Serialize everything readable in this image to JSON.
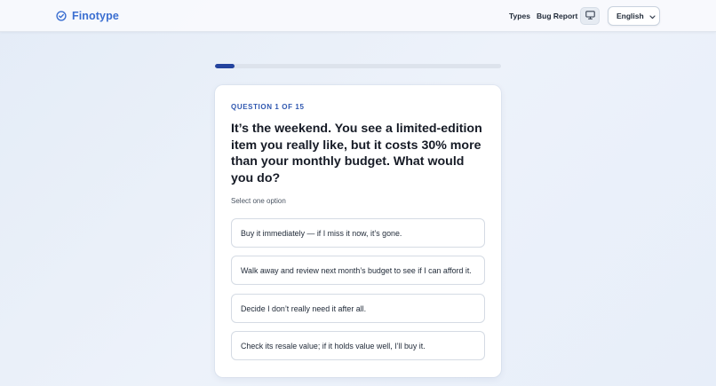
{
  "header": {
    "brand_name": "Finotype",
    "brand_icon": "check-circle-icon",
    "nav": {
      "types": "Types",
      "bug_report": "Bug Report"
    },
    "display_icon": "monitor-icon",
    "language": "English",
    "brand_color": "#3b6fd1"
  },
  "progress": {
    "current": 1,
    "total": 15,
    "fraction": 0.067,
    "color": "#24439e"
  },
  "question": {
    "counter": "QUESTION 1 OF 15",
    "text": "It’s the weekend. You see a limited-edition item you really like, but it costs 30% more than your monthly budget. What would you do?",
    "hint": "Select one option",
    "options": [
      "Buy it immediately — if I miss it now, it’s gone.",
      "Walk away and review next month’s budget to see if I can afford it.",
      "Decide I don’t really need it after all.",
      "Check its resale value; if it holds value well, I’ll buy it."
    ]
  }
}
